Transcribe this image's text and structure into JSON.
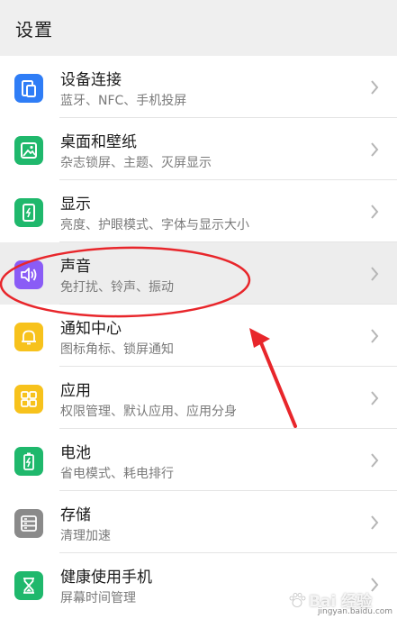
{
  "header": {
    "title": "设置"
  },
  "settings": {
    "items": [
      {
        "label": "设备连接",
        "sub": "蓝牙、NFC、手机投屏",
        "icon": "device-connection-icon",
        "color": "#2f7df6"
      },
      {
        "label": "桌面和壁纸",
        "sub": "杂志锁屏、主题、灭屏显示",
        "icon": "wallpaper-icon",
        "color": "#1fb86c"
      },
      {
        "label": "显示",
        "sub": "亮度、护眼模式、字体与显示大小",
        "icon": "display-icon",
        "color": "#1fb86c"
      },
      {
        "label": "声音",
        "sub": "免打扰、铃声、振动",
        "icon": "sound-icon",
        "color": "#8a5cf6"
      },
      {
        "label": "通知中心",
        "sub": "图标角标、锁屏通知",
        "icon": "bell-icon",
        "color": "#f7c21c"
      },
      {
        "label": "应用",
        "sub": "权限管理、默认应用、应用分身",
        "icon": "apps-grid-icon",
        "color": "#f7c21c"
      },
      {
        "label": "电池",
        "sub": "省电模式、耗电排行",
        "icon": "battery-icon",
        "color": "#1fb86c"
      },
      {
        "label": "存储",
        "sub": "清理加速",
        "icon": "storage-icon",
        "color": "#8a8a8a"
      },
      {
        "label": "健康使用手机",
        "sub": "屏幕时间管理",
        "icon": "hourglass-icon",
        "color": "#1fb86c"
      }
    ]
  },
  "annotation": {
    "color": "#e8262b"
  },
  "watermark": {
    "text": "Bai 经验",
    "url": "jingyan.baidu.com"
  }
}
